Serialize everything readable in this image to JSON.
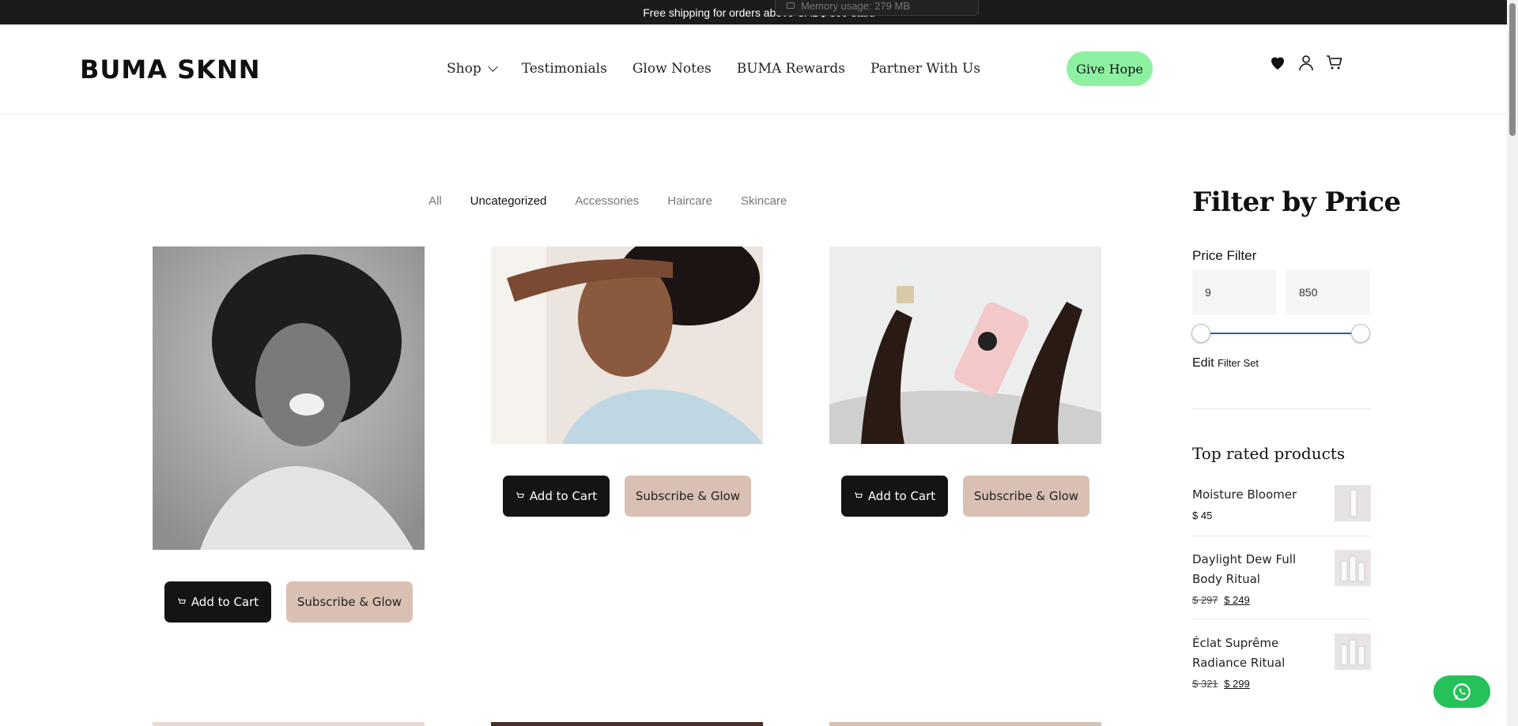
{
  "announcement": {
    "pre": "Free shipping for orders above CAD$",
    "amount": "300",
    "post": "starti",
    "overlay_text": "Memory usage: 279 MB"
  },
  "header": {
    "logo": "BUMA SKNN",
    "nav": [
      {
        "label": "Shop"
      },
      {
        "label": "Testimonials"
      },
      {
        "label": "Glow Notes"
      },
      {
        "label": "BUMA Rewards"
      },
      {
        "label": "Partner With Us"
      }
    ],
    "cta": "Give Hope",
    "icons": [
      "heart-icon",
      "user-icon",
      "cart-icon"
    ],
    "cta_color": "#8ef1a2"
  },
  "filters": {
    "tabs": [
      "All",
      "Uncategorized",
      "Accessories",
      "Haircare",
      "Skincare"
    ],
    "active": "Uncategorized"
  },
  "products": [
    {
      "cart_label": "Add to Cart",
      "subscribe_label": "Subscribe & Glow"
    },
    {
      "cart_label": "Add to Cart",
      "subscribe_label": "Subscribe & Glow"
    },
    {
      "cart_label": "Add to Cart",
      "subscribe_label": "Subscribe & Glow"
    }
  ],
  "sidebar": {
    "title": "Filter by Price",
    "price_filter_label": "Price Filter",
    "min": "9",
    "max": "850",
    "edit_label": "Edit",
    "edit_suffix": "Filter Set",
    "top_rated_title": "Top rated products",
    "top_rated": [
      {
        "name": "Moisture Bloomer",
        "price": "$ 45",
        "old_price": ""
      },
      {
        "name": "Daylight Dew Full Body Ritual",
        "price": "$ 249",
        "old_price": "$ 297"
      },
      {
        "name": "Éclat Suprême Radiance Ritual",
        "price": "$ 299",
        "old_price": "$ 321"
      }
    ]
  },
  "colors": {
    "dark_button": "#141414",
    "subscribe_button": "#d9c0b3",
    "whatsapp": "#25c25a",
    "slider": "#2a5fb0"
  }
}
